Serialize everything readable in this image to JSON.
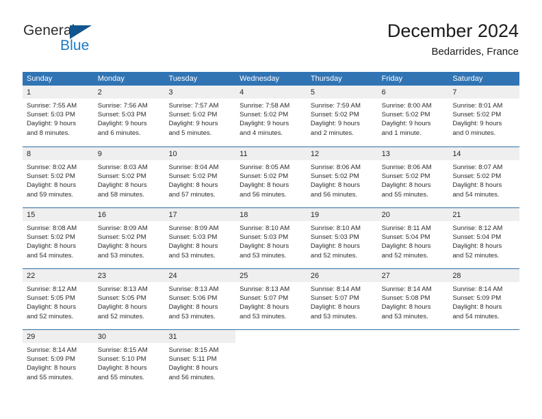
{
  "logo": {
    "word1": "General",
    "word2": "Blue",
    "triangle_color": "#10558f",
    "blue_color": "#1c79c0"
  },
  "header": {
    "title": "December 2024",
    "location": "Bedarrides, France"
  },
  "theme": {
    "header_blue": "#3074b4",
    "row_border_blue": "#2e6da4",
    "daynum_bg": "#efefef"
  },
  "weekdays": [
    "Sunday",
    "Monday",
    "Tuesday",
    "Wednesday",
    "Thursday",
    "Friday",
    "Saturday"
  ],
  "weeks": [
    [
      {
        "day": "1",
        "lines": [
          "Sunrise: 7:55 AM",
          "Sunset: 5:03 PM",
          "Daylight: 9 hours",
          "and 8 minutes."
        ]
      },
      {
        "day": "2",
        "lines": [
          "Sunrise: 7:56 AM",
          "Sunset: 5:03 PM",
          "Daylight: 9 hours",
          "and 6 minutes."
        ]
      },
      {
        "day": "3",
        "lines": [
          "Sunrise: 7:57 AM",
          "Sunset: 5:02 PM",
          "Daylight: 9 hours",
          "and 5 minutes."
        ]
      },
      {
        "day": "4",
        "lines": [
          "Sunrise: 7:58 AM",
          "Sunset: 5:02 PM",
          "Daylight: 9 hours",
          "and 4 minutes."
        ]
      },
      {
        "day": "5",
        "lines": [
          "Sunrise: 7:59 AM",
          "Sunset: 5:02 PM",
          "Daylight: 9 hours",
          "and 2 minutes."
        ]
      },
      {
        "day": "6",
        "lines": [
          "Sunrise: 8:00 AM",
          "Sunset: 5:02 PM",
          "Daylight: 9 hours",
          "and 1 minute."
        ]
      },
      {
        "day": "7",
        "lines": [
          "Sunrise: 8:01 AM",
          "Sunset: 5:02 PM",
          "Daylight: 9 hours",
          "and 0 minutes."
        ]
      }
    ],
    [
      {
        "day": "8",
        "lines": [
          "Sunrise: 8:02 AM",
          "Sunset: 5:02 PM",
          "Daylight: 8 hours",
          "and 59 minutes."
        ]
      },
      {
        "day": "9",
        "lines": [
          "Sunrise: 8:03 AM",
          "Sunset: 5:02 PM",
          "Daylight: 8 hours",
          "and 58 minutes."
        ]
      },
      {
        "day": "10",
        "lines": [
          "Sunrise: 8:04 AM",
          "Sunset: 5:02 PM",
          "Daylight: 8 hours",
          "and 57 minutes."
        ]
      },
      {
        "day": "11",
        "lines": [
          "Sunrise: 8:05 AM",
          "Sunset: 5:02 PM",
          "Daylight: 8 hours",
          "and 56 minutes."
        ]
      },
      {
        "day": "12",
        "lines": [
          "Sunrise: 8:06 AM",
          "Sunset: 5:02 PM",
          "Daylight: 8 hours",
          "and 56 minutes."
        ]
      },
      {
        "day": "13",
        "lines": [
          "Sunrise: 8:06 AM",
          "Sunset: 5:02 PM",
          "Daylight: 8 hours",
          "and 55 minutes."
        ]
      },
      {
        "day": "14",
        "lines": [
          "Sunrise: 8:07 AM",
          "Sunset: 5:02 PM",
          "Daylight: 8 hours",
          "and 54 minutes."
        ]
      }
    ],
    [
      {
        "day": "15",
        "lines": [
          "Sunrise: 8:08 AM",
          "Sunset: 5:02 PM",
          "Daylight: 8 hours",
          "and 54 minutes."
        ]
      },
      {
        "day": "16",
        "lines": [
          "Sunrise: 8:09 AM",
          "Sunset: 5:02 PM",
          "Daylight: 8 hours",
          "and 53 minutes."
        ]
      },
      {
        "day": "17",
        "lines": [
          "Sunrise: 8:09 AM",
          "Sunset: 5:03 PM",
          "Daylight: 8 hours",
          "and 53 minutes."
        ]
      },
      {
        "day": "18",
        "lines": [
          "Sunrise: 8:10 AM",
          "Sunset: 5:03 PM",
          "Daylight: 8 hours",
          "and 53 minutes."
        ]
      },
      {
        "day": "19",
        "lines": [
          "Sunrise: 8:10 AM",
          "Sunset: 5:03 PM",
          "Daylight: 8 hours",
          "and 52 minutes."
        ]
      },
      {
        "day": "20",
        "lines": [
          "Sunrise: 8:11 AM",
          "Sunset: 5:04 PM",
          "Daylight: 8 hours",
          "and 52 minutes."
        ]
      },
      {
        "day": "21",
        "lines": [
          "Sunrise: 8:12 AM",
          "Sunset: 5:04 PM",
          "Daylight: 8 hours",
          "and 52 minutes."
        ]
      }
    ],
    [
      {
        "day": "22",
        "lines": [
          "Sunrise: 8:12 AM",
          "Sunset: 5:05 PM",
          "Daylight: 8 hours",
          "and 52 minutes."
        ]
      },
      {
        "day": "23",
        "lines": [
          "Sunrise: 8:13 AM",
          "Sunset: 5:05 PM",
          "Daylight: 8 hours",
          "and 52 minutes."
        ]
      },
      {
        "day": "24",
        "lines": [
          "Sunrise: 8:13 AM",
          "Sunset: 5:06 PM",
          "Daylight: 8 hours",
          "and 53 minutes."
        ]
      },
      {
        "day": "25",
        "lines": [
          "Sunrise: 8:13 AM",
          "Sunset: 5:07 PM",
          "Daylight: 8 hours",
          "and 53 minutes."
        ]
      },
      {
        "day": "26",
        "lines": [
          "Sunrise: 8:14 AM",
          "Sunset: 5:07 PM",
          "Daylight: 8 hours",
          "and 53 minutes."
        ]
      },
      {
        "day": "27",
        "lines": [
          "Sunrise: 8:14 AM",
          "Sunset: 5:08 PM",
          "Daylight: 8 hours",
          "and 53 minutes."
        ]
      },
      {
        "day": "28",
        "lines": [
          "Sunrise: 8:14 AM",
          "Sunset: 5:09 PM",
          "Daylight: 8 hours",
          "and 54 minutes."
        ]
      }
    ],
    [
      {
        "day": "29",
        "lines": [
          "Sunrise: 8:14 AM",
          "Sunset: 5:09 PM",
          "Daylight: 8 hours",
          "and 55 minutes."
        ]
      },
      {
        "day": "30",
        "lines": [
          "Sunrise: 8:15 AM",
          "Sunset: 5:10 PM",
          "Daylight: 8 hours",
          "and 55 minutes."
        ]
      },
      {
        "day": "31",
        "lines": [
          "Sunrise: 8:15 AM",
          "Sunset: 5:11 PM",
          "Daylight: 8 hours",
          "and 56 minutes."
        ]
      },
      {
        "day": "",
        "lines": []
      },
      {
        "day": "",
        "lines": []
      },
      {
        "day": "",
        "lines": []
      },
      {
        "day": "",
        "lines": []
      }
    ]
  ]
}
